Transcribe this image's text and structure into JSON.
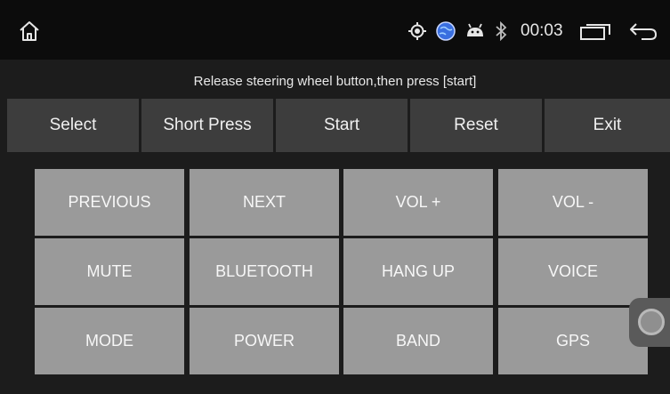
{
  "status_bar": {
    "time": "00:03",
    "icons": [
      "home-icon",
      "gps-icon",
      "globe-icon",
      "android-icon",
      "bluetooth-icon",
      "recent-apps-icon",
      "back-icon"
    ]
  },
  "instruction": "Release steering wheel button,then press [start]",
  "toolbar": {
    "select": "Select",
    "short_press": "Short Press",
    "start": "Start",
    "reset": "Reset",
    "exit": "Exit"
  },
  "keys": [
    "PREVIOUS",
    "NEXT",
    "VOL +",
    "VOL -",
    "MUTE",
    "BLUETOOTH",
    "HANG UP",
    "VOICE",
    "MODE",
    "POWER",
    "BAND",
    "GPS"
  ],
  "colors": {
    "background": "#1c1c1c",
    "status_bar": "#0c0c0c",
    "toolbar_button": "#3d3d3d",
    "key": "#9a9a9a",
    "globe": "#3a6fe0"
  }
}
